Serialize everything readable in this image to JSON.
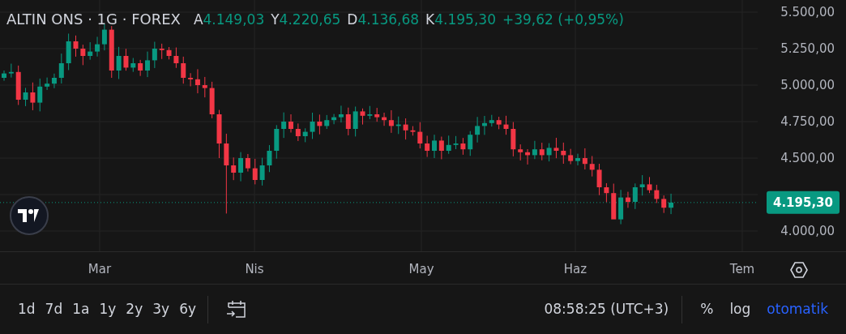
{
  "header": {
    "title": "ALTIN ONS · 1G · FOREX",
    "ohlc": [
      {
        "label": "A",
        "value": "4.149,03"
      },
      {
        "label": "Y",
        "value": "4.220,65"
      },
      {
        "label": "D",
        "value": "4.136,68"
      },
      {
        "label": "K",
        "value": "4.195,30"
      }
    ],
    "change": "+39,62 (+0,95%)"
  },
  "price_axis": {
    "labels": [
      "5.500,00",
      "5.250,00",
      "5.000,00",
      "4.750,00",
      "4.500,00",
      "4.000,00"
    ],
    "current_price": "4.195,30"
  },
  "time_axis": {
    "labels": [
      "Mar",
      "Nis",
      "May",
      "Haz",
      "Tem"
    ]
  },
  "toolbar": {
    "ranges": [
      "1d",
      "7d",
      "1a",
      "1y",
      "2y",
      "3y",
      "6y"
    ],
    "time": "08:58:25 (UTC+3)",
    "toggles": [
      {
        "label": "%",
        "selected": false
      },
      {
        "label": "log",
        "selected": false
      },
      {
        "label": "otomatik",
        "selected": true
      }
    ]
  }
}
